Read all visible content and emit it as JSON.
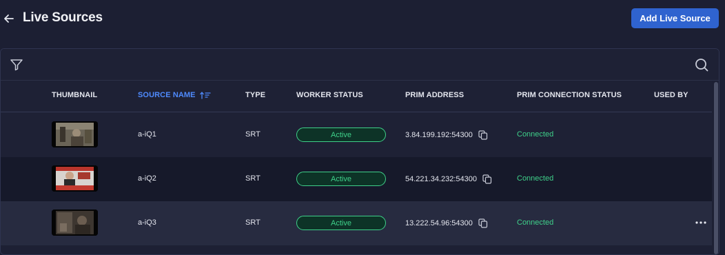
{
  "header": {
    "title": "Live Sources",
    "add_button": "Add Live Source"
  },
  "toolbar": {
    "filter_icon": "filter-icon",
    "search_icon": "search-icon"
  },
  "table": {
    "columns": {
      "thumbnail": "THUMBNAIL",
      "source_name": "SOURCE NAME",
      "type": "TYPE",
      "worker_status": "WORKER STATUS",
      "prim_address": "PRIM ADDRESS",
      "prim_connection_status": "PRIM CONNECTION STATUS",
      "used_by": "USED BY"
    },
    "sort": {
      "column": "source_name",
      "direction": "ascending"
    },
    "rows": [
      {
        "source_name": "a-iQ1",
        "type": "SRT",
        "worker_status": "Active",
        "prim_address": "3.84.199.192:54300",
        "prim_connection_status": "Connected",
        "used_by": ""
      },
      {
        "source_name": "a-iQ2",
        "type": "SRT",
        "worker_status": "Active",
        "prim_address": "54.221.34.232:54300",
        "prim_connection_status": "Connected",
        "used_by": ""
      },
      {
        "source_name": "a-iQ3",
        "type": "SRT",
        "worker_status": "Active",
        "prim_address": "13.222.54.96:54300",
        "prim_connection_status": "Connected",
        "used_by": ""
      }
    ]
  },
  "colors": {
    "accent": "#2f63cf",
    "sort_active": "#4f8bff",
    "status_green": "#3fd18a",
    "background": "#1c1f33"
  }
}
